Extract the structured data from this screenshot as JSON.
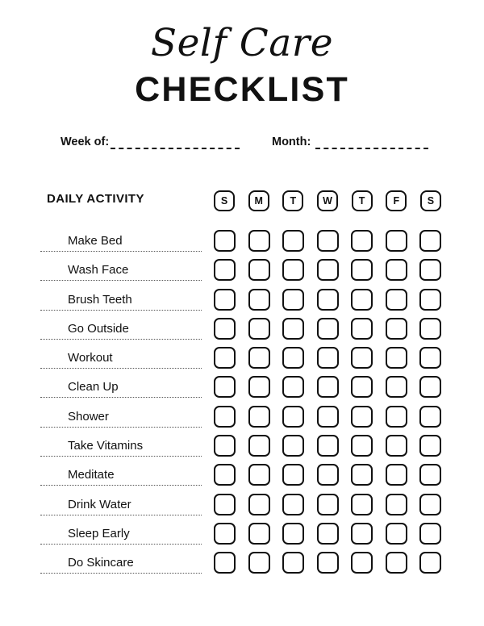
{
  "document": {
    "title_script": "Self Care",
    "title_block": "CHECKLIST"
  },
  "meta": {
    "week_label": "Week of:",
    "week_value": "",
    "month_label": "Month:",
    "month_value": ""
  },
  "table": {
    "activity_column_header": "DAILY ACTIVITY",
    "day_headers": [
      "S",
      "M",
      "T",
      "W",
      "T",
      "F",
      "S"
    ],
    "rows": [
      {
        "activity": "Make Bed",
        "checks": [
          false,
          false,
          false,
          false,
          false,
          false,
          false
        ]
      },
      {
        "activity": "Wash Face",
        "checks": [
          false,
          false,
          false,
          false,
          false,
          false,
          false
        ]
      },
      {
        "activity": "Brush Teeth",
        "checks": [
          false,
          false,
          false,
          false,
          false,
          false,
          false
        ]
      },
      {
        "activity": "Go Outside",
        "checks": [
          false,
          false,
          false,
          false,
          false,
          false,
          false
        ]
      },
      {
        "activity": "Workout",
        "checks": [
          false,
          false,
          false,
          false,
          false,
          false,
          false
        ]
      },
      {
        "activity": "Clean Up",
        "checks": [
          false,
          false,
          false,
          false,
          false,
          false,
          false
        ]
      },
      {
        "activity": "Shower",
        "checks": [
          false,
          false,
          false,
          false,
          false,
          false,
          false
        ]
      },
      {
        "activity": "Take Vitamins",
        "checks": [
          false,
          false,
          false,
          false,
          false,
          false,
          false
        ]
      },
      {
        "activity": "Meditate",
        "checks": [
          false,
          false,
          false,
          false,
          false,
          false,
          false
        ]
      },
      {
        "activity": "Drink Water",
        "checks": [
          false,
          false,
          false,
          false,
          false,
          false,
          false
        ]
      },
      {
        "activity": "Sleep Early",
        "checks": [
          false,
          false,
          false,
          false,
          false,
          false,
          false
        ]
      },
      {
        "activity": "Do Skincare",
        "checks": [
          false,
          false,
          false,
          false,
          false,
          false,
          false
        ]
      }
    ]
  },
  "colors": {
    "ink": "#111111",
    "paper": "#ffffff",
    "rule": "#555555"
  }
}
